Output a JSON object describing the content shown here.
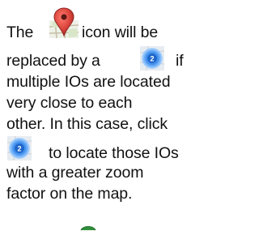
{
  "paragraph": {
    "line1": {
      "before": "The",
      "after": "icon will be"
    },
    "line2": {
      "before": "replaced by a",
      "after": "if"
    },
    "line3": "multiple IOs are located",
    "line4": "very close to each",
    "line5": "other. In this case, click",
    "line6": {
      "after": "to locate those IOs"
    },
    "line7": "with a greater zoom",
    "line8": "factor on the map."
  },
  "icons": {
    "marker": "map-pin-icon",
    "cluster": "cluster-icon",
    "cluster_count": "2"
  },
  "colors": {
    "text": "#111111",
    "pin": "#d9433a",
    "cluster": "#2f7fe0"
  }
}
